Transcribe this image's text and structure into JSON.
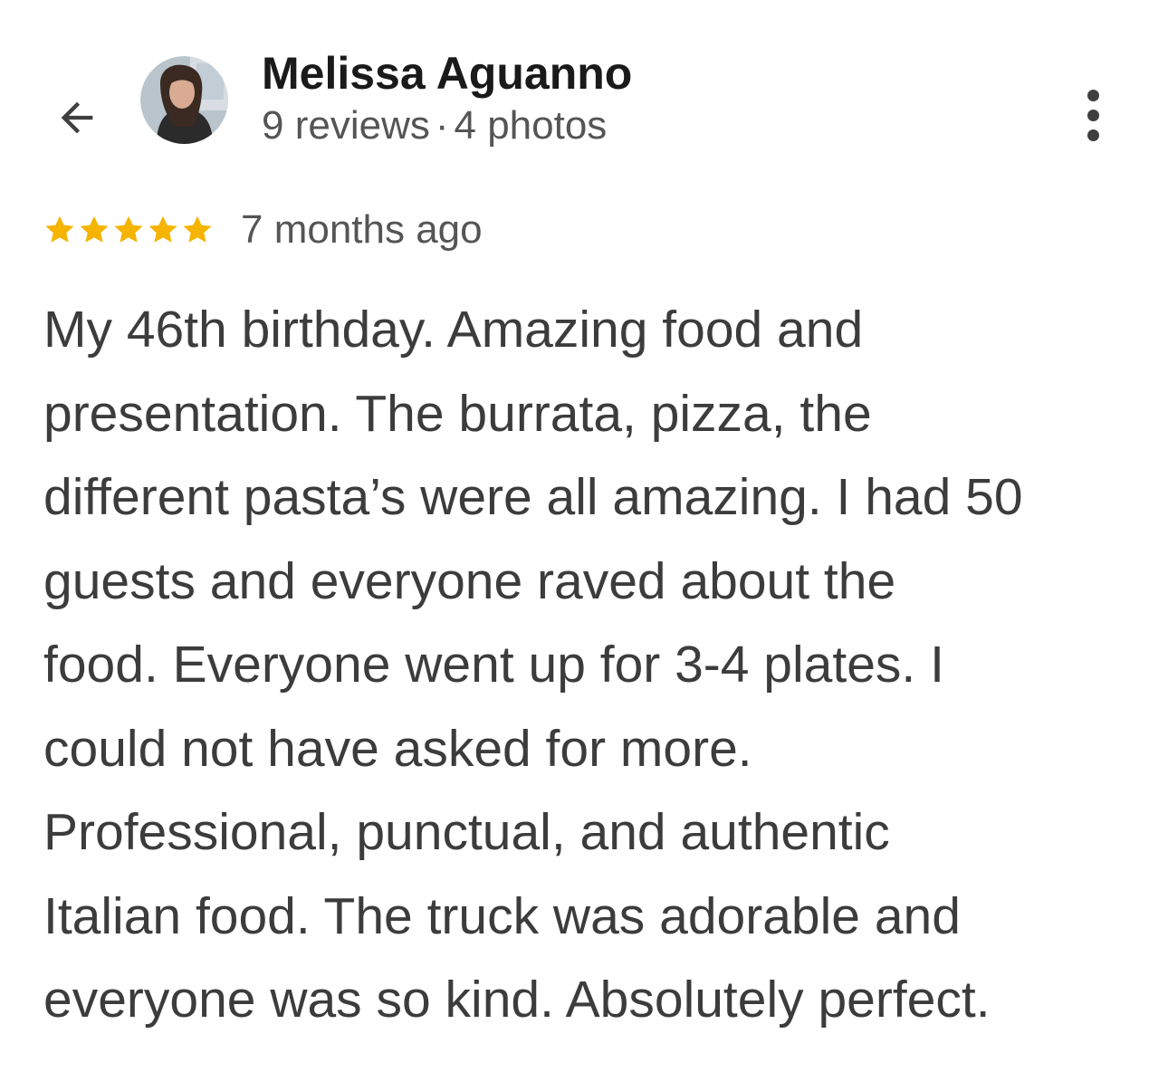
{
  "header": {
    "back_icon": "arrow-left-icon",
    "avatar_alt": "Melissa Aguanno",
    "name": "Melissa Aguanno",
    "reviews": "9 reviews",
    "separator": "·",
    "photos": "4 photos",
    "more_icon": "more-vertical-icon"
  },
  "rating": {
    "stars": 5,
    "max_stars": 5,
    "star_color": "#f5b400",
    "time_ago": "7 months ago"
  },
  "review": {
    "lines": [
      "My 46th birthday. Amazing food and",
      "presentation. The burrata, pizza, the",
      "different pasta’s were all amazing. I had 50",
      "guests and everyone raved about the",
      "food. Everyone went up for 3-4 plates. I",
      "could not have asked for more.",
      "Professional, punctual, and authentic",
      "Italian food. The truck was adorable and",
      "everyone was so kind. Absolutely perfect."
    ]
  }
}
